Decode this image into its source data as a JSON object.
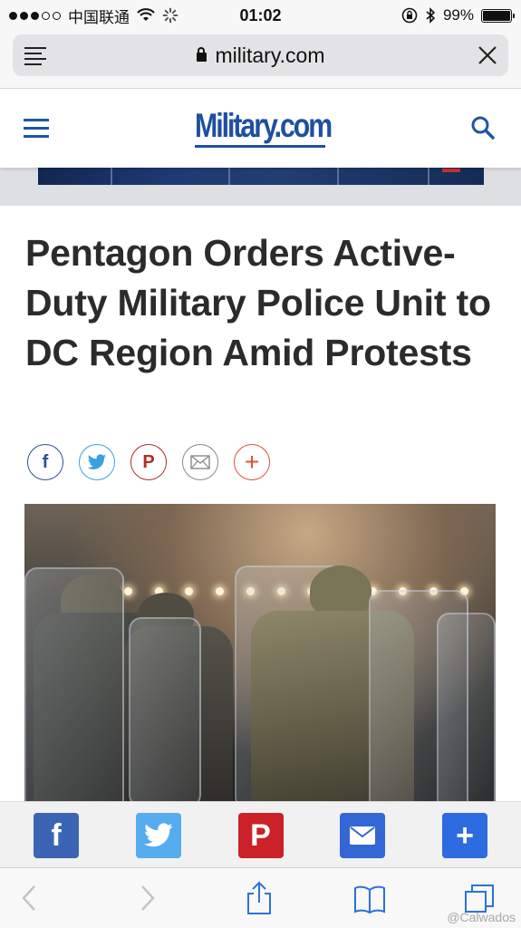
{
  "status_bar": {
    "carrier": "中国联通",
    "time": "01:02",
    "battery_text": "99%",
    "battery_level": 0.99,
    "signal_bars_filled": 3,
    "signal_bars_total": 5
  },
  "browser": {
    "url": "military.com",
    "reader_icon": "reader-lines-icon",
    "close_icon": "close-icon"
  },
  "site": {
    "logo": "Military.com",
    "menu_icon": "hamburger-icon",
    "search_icon": "search-icon",
    "brand_color": "#1f4fa0"
  },
  "article": {
    "headline": "Pentagon Orders Active-Duty Military Police Unit to DC Region Amid Protests",
    "share_buttons": [
      {
        "icon": "facebook-icon",
        "glyph": "f"
      },
      {
        "icon": "twitter-icon",
        "glyph": "t"
      },
      {
        "icon": "pinterest-icon",
        "glyph": "P"
      },
      {
        "icon": "mail-icon",
        "glyph": "✉"
      },
      {
        "icon": "plus-icon",
        "glyph": "+"
      }
    ]
  },
  "share_bar": {
    "buttons": [
      {
        "icon": "facebook-icon",
        "glyph": "f",
        "color": "#3b65b4"
      },
      {
        "icon": "twitter-icon",
        "glyph": "t",
        "color": "#55acee"
      },
      {
        "icon": "pinterest-icon",
        "glyph": "P",
        "color": "#cb2128"
      },
      {
        "icon": "mail-icon",
        "glyph": "✉",
        "color": "#3367d6"
      },
      {
        "icon": "plus-icon",
        "glyph": "+",
        "color": "#2c6be0"
      }
    ]
  },
  "toolbar": {
    "items": [
      "back-icon",
      "forward-icon",
      "share-icon",
      "bookmarks-icon",
      "tabs-icon"
    ]
  },
  "watermark": "@Calwados"
}
